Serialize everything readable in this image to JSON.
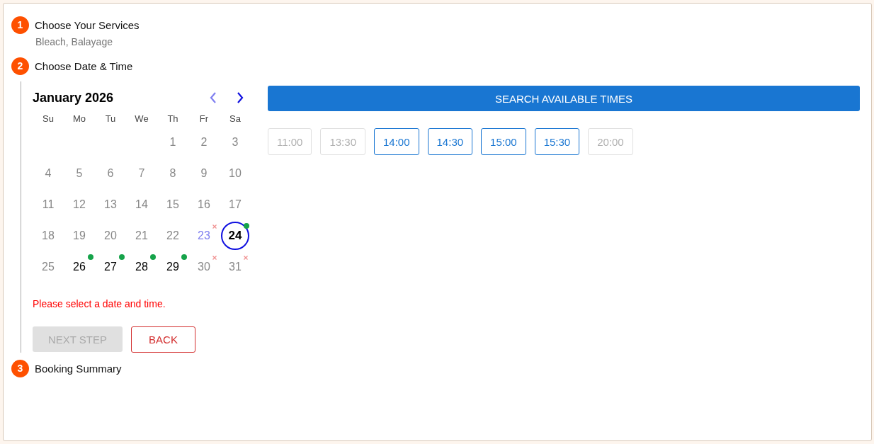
{
  "steps": [
    {
      "number": "1",
      "title": "Choose Your Services",
      "summary": "Bleach, Balayage"
    },
    {
      "number": "2",
      "title": "Choose Date & Time"
    },
    {
      "number": "3",
      "title": "Booking Summary"
    }
  ],
  "calendar": {
    "month": "January 2026",
    "prev_disabled": true,
    "next_disabled": false,
    "weekdays": [
      "Su",
      "Mo",
      "Tu",
      "We",
      "Th",
      "Fr",
      "Sa"
    ],
    "weeks": [
      [
        {
          "label": "1",
          "selected": false,
          "disabled": true,
          "today": false,
          "available": false,
          "unavailable": false
        },
        {
          "label": "2",
          "selected": false,
          "disabled": true,
          "today": false,
          "available": false,
          "unavailable": false
        },
        {
          "label": "3",
          "selected": false,
          "disabled": true,
          "today": false,
          "available": false,
          "unavailable": false
        }
      ],
      [
        {
          "label": "4",
          "selected": false,
          "disabled": true,
          "today": false,
          "available": false,
          "unavailable": false
        },
        {
          "label": "5",
          "selected": false,
          "disabled": true,
          "today": false,
          "available": false,
          "unavailable": false
        },
        {
          "label": "6",
          "selected": false,
          "disabled": true,
          "today": false,
          "available": false,
          "unavailable": false
        },
        {
          "label": "7",
          "selected": false,
          "disabled": true,
          "today": false,
          "available": false,
          "unavailable": false
        },
        {
          "label": "8",
          "selected": false,
          "disabled": true,
          "today": false,
          "available": false,
          "unavailable": false
        },
        {
          "label": "9",
          "selected": false,
          "disabled": true,
          "today": false,
          "available": false,
          "unavailable": false
        },
        {
          "label": "10",
          "selected": false,
          "disabled": true,
          "today": false,
          "available": false,
          "unavailable": false
        }
      ],
      [
        {
          "label": "11",
          "selected": false,
          "disabled": true,
          "today": false,
          "available": false,
          "unavailable": false
        },
        {
          "label": "12",
          "selected": false,
          "disabled": true,
          "today": false,
          "available": false,
          "unavailable": false
        },
        {
          "label": "13",
          "selected": false,
          "disabled": true,
          "today": false,
          "available": false,
          "unavailable": false
        },
        {
          "label": "14",
          "selected": false,
          "disabled": true,
          "today": false,
          "available": false,
          "unavailable": false
        },
        {
          "label": "15",
          "selected": false,
          "disabled": true,
          "today": false,
          "available": false,
          "unavailable": false
        },
        {
          "label": "16",
          "selected": false,
          "disabled": true,
          "today": false,
          "available": false,
          "unavailable": false
        },
        {
          "label": "17",
          "selected": false,
          "disabled": true,
          "today": false,
          "available": false,
          "unavailable": false
        }
      ],
      [
        {
          "label": "18",
          "selected": false,
          "disabled": true,
          "today": false,
          "available": false,
          "unavailable": false
        },
        {
          "label": "19",
          "selected": false,
          "disabled": true,
          "today": false,
          "available": false,
          "unavailable": false
        },
        {
          "label": "20",
          "selected": false,
          "disabled": true,
          "today": false,
          "available": false,
          "unavailable": false
        },
        {
          "label": "21",
          "selected": false,
          "disabled": true,
          "today": false,
          "available": false,
          "unavailable": false
        },
        {
          "label": "22",
          "selected": false,
          "disabled": true,
          "today": false,
          "available": false,
          "unavailable": false
        },
        {
          "label": "23",
          "selected": false,
          "disabled": false,
          "today": true,
          "available": false,
          "unavailable": true
        },
        {
          "label": "24",
          "selected": true,
          "disabled": false,
          "today": false,
          "available": true,
          "unavailable": false
        }
      ],
      [
        {
          "label": "25",
          "selected": false,
          "disabled": true,
          "today": false,
          "available": false,
          "unavailable": false
        },
        {
          "label": "26",
          "selected": false,
          "disabled": false,
          "today": false,
          "available": true,
          "unavailable": false
        },
        {
          "label": "27",
          "selected": false,
          "disabled": false,
          "today": false,
          "available": true,
          "unavailable": false
        },
        {
          "label": "28",
          "selected": false,
          "disabled": false,
          "today": false,
          "available": true,
          "unavailable": false
        },
        {
          "label": "29",
          "selected": false,
          "disabled": false,
          "today": false,
          "available": true,
          "unavailable": false
        },
        {
          "label": "30",
          "selected": false,
          "disabled": true,
          "today": false,
          "available": false,
          "unavailable": true
        },
        {
          "label": "31",
          "selected": false,
          "disabled": true,
          "today": false,
          "available": false,
          "unavailable": true
        }
      ]
    ]
  },
  "error": "Please select a date and time.",
  "buttons": {
    "next": {
      "label": "NEXT STEP",
      "disabled": true
    },
    "back": {
      "label": "BACK"
    }
  },
  "search_button": "SEARCH AVAILABLE TIMES",
  "time_slots": [
    {
      "label": "11:00",
      "disabled": true
    },
    {
      "label": "13:30",
      "disabled": true
    },
    {
      "label": "14:00",
      "disabled": false
    },
    {
      "label": "14:30",
      "disabled": false
    },
    {
      "label": "15:00",
      "disabled": false
    },
    {
      "label": "15:30",
      "disabled": false
    },
    {
      "label": "20:00",
      "disabled": true
    }
  ]
}
